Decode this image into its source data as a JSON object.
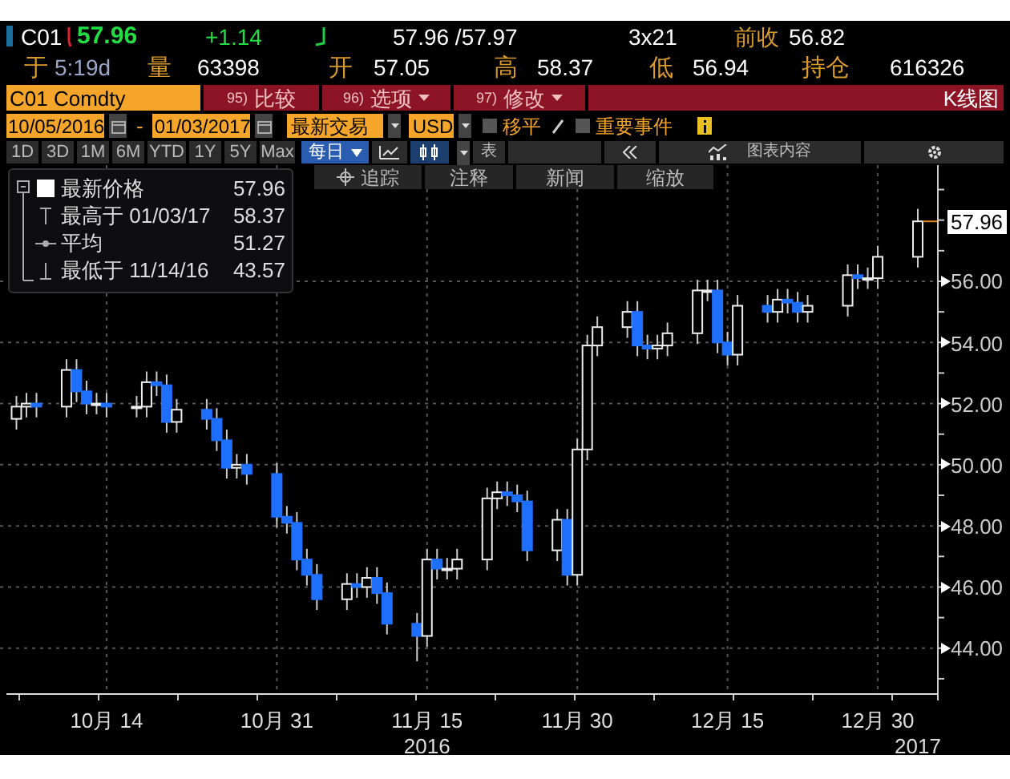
{
  "quote": {
    "ticker": "C01",
    "last": "57.96",
    "change": "+1.14",
    "bid_ask": "57.96 /57.97",
    "size": "3x21",
    "prev_close_label": "前收",
    "prev_close": "56.82"
  },
  "stats": [
    {
      "label": "于",
      "value": "5:19d"
    },
    {
      "label": "量",
      "value": "63398"
    },
    {
      "label": "开",
      "value": "57.05"
    },
    {
      "label": "高",
      "value": "58.37"
    },
    {
      "label": "低",
      "value": "56.94"
    },
    {
      "label": "持仓",
      "value": "616326"
    }
  ],
  "security": "C01 Comdty",
  "actions": [
    {
      "number": "95)",
      "label": "比较",
      "dropdown": false
    },
    {
      "number": "96)",
      "label": "选项",
      "dropdown": true
    },
    {
      "number": "97)",
      "label": "修改",
      "dropdown": true
    }
  ],
  "chart_title": "K线图",
  "start_date": "10/05/2016",
  "date_separator": "-",
  "end_date": "01/03/2017",
  "price_field": "最新交易",
  "currency": "USD",
  "toggles": [
    {
      "label": "移平",
      "checked": false
    },
    {
      "label": "重要事件",
      "checked": false
    }
  ],
  "periods": [
    {
      "label": "1D",
      "selected": false
    },
    {
      "label": "3D",
      "selected": false
    },
    {
      "label": "1M",
      "selected": false
    },
    {
      "label": "6M",
      "selected": false
    },
    {
      "label": "YTD",
      "selected": false
    },
    {
      "label": "1Y",
      "selected": false
    },
    {
      "label": "5Y",
      "selected": false
    },
    {
      "label": "Max",
      "selected": false
    }
  ],
  "frequency": "每日",
  "table_button": "表",
  "chart_contents": "图表内容",
  "tools": [
    {
      "label": "追踪",
      "icon": true
    },
    {
      "label": "注释",
      "icon": false
    },
    {
      "label": "新闻",
      "icon": false
    },
    {
      "label": "缩放",
      "icon": false
    }
  ],
  "legend": {
    "expanded": true,
    "items": [
      {
        "kind": "last",
        "label": "最新价格",
        "value": "57.96"
      },
      {
        "kind": "high",
        "label": "最高于 01/03/17",
        "value": "58.37"
      },
      {
        "kind": "average",
        "label": "平均",
        "value": "51.27"
      },
      {
        "kind": "low",
        "label": "最低于 11/14/16",
        "value": "43.57"
      }
    ]
  },
  "price_tag": "57.96",
  "chart_data": {
    "type": "candlestick",
    "grid": true,
    "xlim": [
      "2016-10-04",
      "2017-01-05"
    ],
    "ylim": [
      42.5,
      59.8
    ],
    "yticks": [
      {
        "value": 44,
        "label": "44.00"
      },
      {
        "value": 46,
        "label": "46.00"
      },
      {
        "value": 48,
        "label": "48.00"
      },
      {
        "value": 50,
        "label": "50.00"
      },
      {
        "value": 52,
        "label": "52.00"
      },
      {
        "value": 54,
        "label": "54.00"
      },
      {
        "value": 56,
        "label": "56.00"
      }
    ],
    "x": [
      "2016-10-05",
      "2016-10-06",
      "2016-10-07",
      "2016-10-10",
      "2016-10-11",
      "2016-10-12",
      "2016-10-13",
      "2016-10-14",
      "2016-10-17",
      "2016-10-18",
      "2016-10-19",
      "2016-10-20",
      "2016-10-21",
      "2016-10-24",
      "2016-10-25",
      "2016-10-26",
      "2016-10-27",
      "2016-10-28",
      "2016-10-31",
      "2016-11-01",
      "2016-11-02",
      "2016-11-03",
      "2016-11-04",
      "2016-11-07",
      "2016-11-08",
      "2016-11-09",
      "2016-11-10",
      "2016-11-11",
      "2016-11-14",
      "2016-11-15",
      "2016-11-16",
      "2016-11-17",
      "2016-11-18",
      "2016-11-21",
      "2016-11-22",
      "2016-11-23",
      "2016-11-24",
      "2016-11-25",
      "2016-11-28",
      "2016-11-29",
      "2016-11-30",
      "2016-12-01",
      "2016-12-02",
      "2016-12-05",
      "2016-12-06",
      "2016-12-07",
      "2016-12-08",
      "2016-12-09",
      "2016-12-12",
      "2016-12-13",
      "2016-12-14",
      "2016-12-15",
      "2016-12-16",
      "2016-12-19",
      "2016-12-20",
      "2016-12-21",
      "2016-12-22",
      "2016-12-23",
      "2016-12-27",
      "2016-12-28",
      "2016-12-29",
      "2016-12-30",
      "2017-01-03"
    ],
    "xticks": [
      {
        "value": "2016-10-14",
        "label": "10月 14"
      },
      {
        "value": "2016-10-31",
        "label": "10月 31"
      },
      {
        "value": "2016-11-15",
        "label": "11月 15"
      },
      {
        "value": "2016-11-30",
        "label": "11月 30"
      },
      {
        "value": "2016-12-15",
        "label": "12月 15"
      },
      {
        "value": "2016-12-30",
        "label": "12月 30"
      }
    ],
    "annotations": [
      "2016",
      "2017"
    ],
    "ohlc": [
      [
        51.5,
        52.25,
        51.15,
        51.9
      ],
      [
        51.9,
        52.35,
        51.55,
        52.0
      ],
      [
        52.0,
        52.35,
        51.55,
        51.9
      ],
      [
        51.9,
        53.45,
        51.55,
        53.1
      ],
      [
        53.1,
        53.45,
        52.05,
        52.4
      ],
      [
        52.4,
        52.75,
        51.65,
        52.0
      ],
      [
        52.0,
        52.35,
        51.65,
        52.0
      ],
      [
        52.0,
        52.35,
        51.55,
        51.9
      ],
      [
        51.9,
        52.25,
        51.55,
        51.9
      ],
      [
        51.9,
        53.05,
        51.55,
        52.7
      ],
      [
        52.7,
        53.05,
        52.25,
        52.6
      ],
      [
        52.6,
        52.95,
        51.05,
        51.4
      ],
      [
        51.4,
        52.15,
        51.05,
        51.8
      ],
      [
        51.8,
        52.15,
        51.15,
        51.5
      ],
      [
        51.5,
        51.85,
        50.45,
        50.8
      ],
      [
        50.8,
        51.15,
        49.55,
        49.9
      ],
      [
        49.9,
        50.35,
        49.55,
        50.0
      ],
      [
        50.0,
        50.35,
        49.35,
        49.7
      ],
      [
        49.7,
        50.05,
        47.95,
        48.3
      ],
      [
        48.3,
        48.65,
        47.75,
        48.1
      ],
      [
        48.1,
        48.45,
        46.55,
        46.9
      ],
      [
        46.9,
        47.25,
        46.05,
        46.4
      ],
      [
        46.4,
        46.75,
        45.25,
        45.6
      ],
      [
        45.6,
        46.45,
        45.25,
        46.1
      ],
      [
        46.1,
        46.45,
        45.65,
        46.0
      ],
      [
        46.0,
        46.65,
        45.65,
        46.3
      ],
      [
        46.3,
        46.65,
        45.45,
        45.8
      ],
      [
        45.8,
        46.15,
        44.45,
        44.8
      ],
      [
        44.8,
        45.15,
        43.57,
        44.4
      ],
      [
        44.4,
        47.25,
        44.05,
        46.9
      ],
      [
        46.9,
        47.25,
        46.25,
        46.6
      ],
      [
        46.6,
        46.95,
        46.25,
        46.6
      ],
      [
        46.6,
        47.25,
        46.25,
        46.9
      ],
      [
        46.9,
        49.25,
        46.55,
        48.9
      ],
      [
        48.9,
        49.45,
        48.55,
        49.1
      ],
      [
        49.1,
        49.45,
        48.65,
        49.0
      ],
      [
        49.0,
        49.35,
        48.45,
        48.8
      ],
      [
        48.8,
        49.15,
        46.85,
        47.2
      ],
      [
        47.2,
        48.55,
        46.85,
        48.2
      ],
      [
        48.2,
        48.55,
        46.05,
        46.4
      ],
      [
        46.4,
        50.85,
        46.05,
        50.5
      ],
      [
        50.5,
        54.25,
        50.15,
        53.9
      ],
      [
        53.9,
        54.85,
        53.55,
        54.5
      ],
      [
        54.5,
        55.35,
        54.15,
        55.0
      ],
      [
        55.0,
        55.35,
        53.55,
        53.9
      ],
      [
        53.9,
        54.25,
        53.45,
        53.8
      ],
      [
        53.8,
        54.25,
        53.45,
        53.9
      ],
      [
        53.9,
        54.65,
        53.55,
        54.3
      ],
      [
        54.3,
        56.05,
        53.95,
        55.7
      ],
      [
        55.7,
        56.05,
        55.35,
        55.7
      ],
      [
        55.7,
        56.05,
        53.65,
        54.0
      ],
      [
        54.0,
        54.35,
        53.25,
        53.6
      ],
      [
        53.6,
        55.55,
        53.25,
        55.2
      ],
      [
        55.2,
        55.55,
        54.65,
        55.0
      ],
      [
        55.0,
        55.75,
        54.65,
        55.4
      ],
      [
        55.4,
        55.75,
        54.95,
        55.3
      ],
      [
        55.3,
        55.65,
        54.65,
        55.0
      ],
      [
        55.0,
        55.55,
        54.65,
        55.2
      ],
      [
        55.2,
        56.55,
        54.85,
        56.2
      ],
      [
        56.2,
        56.55,
        55.75,
        56.1
      ],
      [
        56.1,
        56.45,
        55.75,
        56.1
      ],
      [
        56.1,
        57.15,
        55.75,
        56.8
      ],
      [
        56.8,
        58.37,
        56.45,
        57.96
      ]
    ]
  }
}
